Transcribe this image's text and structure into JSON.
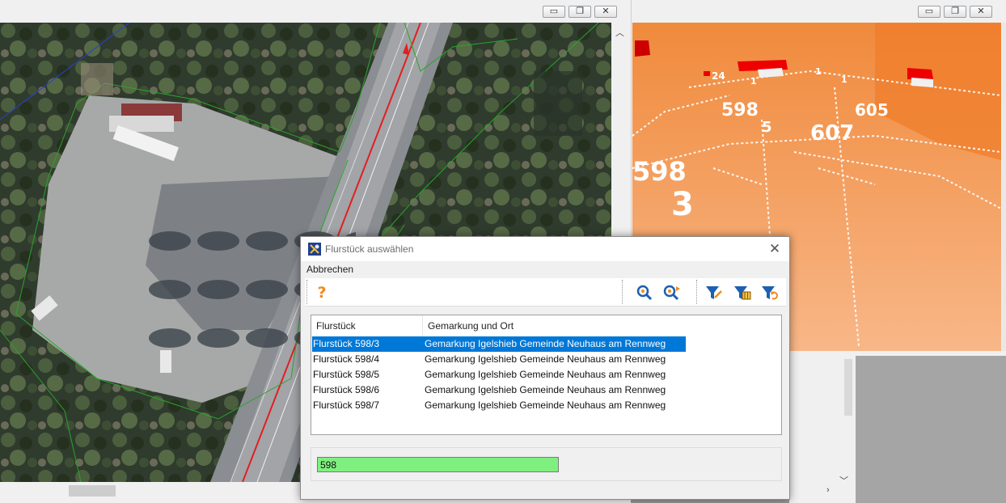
{
  "dialog": {
    "title": "Flurstück auswählen",
    "menu": {
      "cancel": "Abbrechen"
    },
    "toolbar": {
      "help": "?",
      "icons": [
        "help-icon",
        "zoom-parcel-icon",
        "zoom-next-icon",
        "filter-edit-icon",
        "filter-table-icon",
        "filter-reset-icon"
      ]
    },
    "columns": [
      "Flurstück",
      "Gemarkung und Ort"
    ],
    "rows": [
      {
        "parcel": "Flurstück 598/3",
        "location": "Gemarkung Igelshieb Gemeinde Neuhaus am Rennweg",
        "selected": true
      },
      {
        "parcel": "Flurstück 598/4",
        "location": "Gemarkung Igelshieb Gemeinde Neuhaus am Rennweg"
      },
      {
        "parcel": "Flurstück 598/5",
        "location": "Gemarkung Igelshieb Gemeinde Neuhaus am Rennweg"
      },
      {
        "parcel": "Flurstück 598/6",
        "location": "Gemarkung Igelshieb Gemeinde Neuhaus am Rennweg"
      },
      {
        "parcel": "Flurstück 598/7",
        "location": "Gemarkung Igelshieb Gemeinde Neuhaus am Rennweg"
      }
    ],
    "search_value": "598"
  },
  "scene3d": {
    "labels": [
      "598",
      "605",
      "5",
      "607",
      "598",
      "3",
      "24",
      "1",
      "1",
      "1"
    ]
  },
  "colors": {
    "selection": "#0078d7",
    "input_match": "#7ff07f",
    "terrain": "#f5a566",
    "road_line": "#e02020"
  },
  "window_controls": {
    "minimize": "▭",
    "restore": "❐",
    "close": "✕"
  }
}
